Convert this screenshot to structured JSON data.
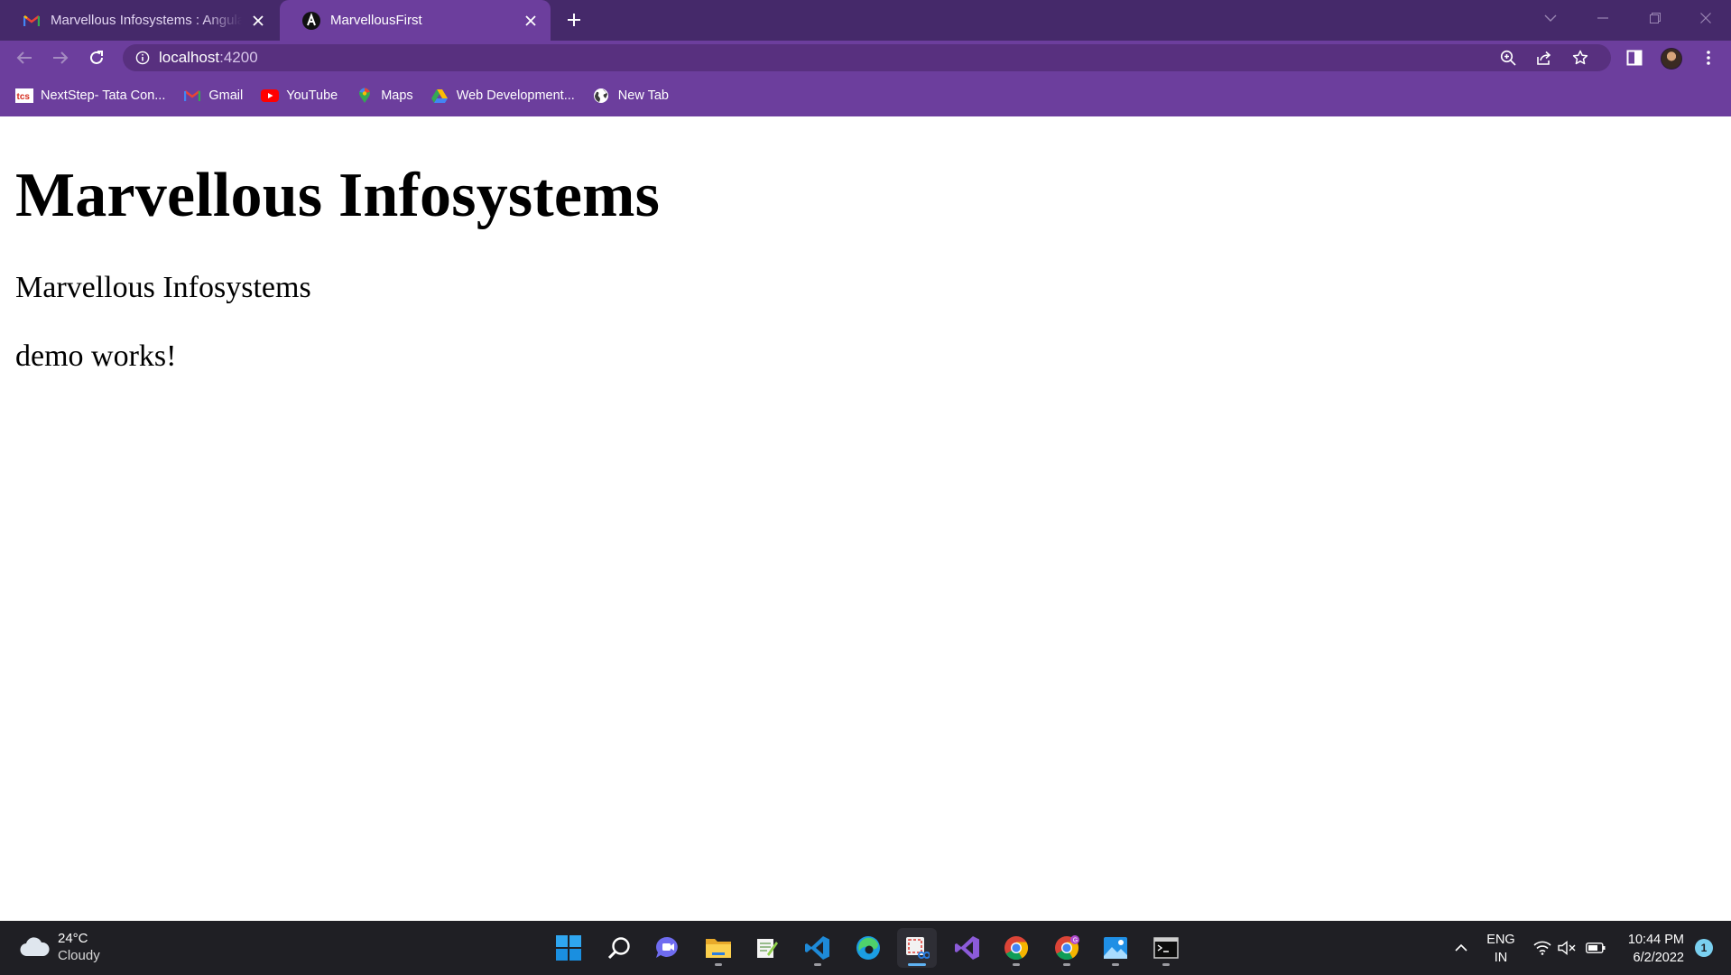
{
  "browser": {
    "tabs": [
      {
        "title": "Marvellous Infosystems : Angular",
        "favicon": "gmail-icon",
        "active": false
      },
      {
        "title": "MarvellousFirst",
        "favicon": "angular-icon",
        "active": true
      }
    ],
    "address_bar": {
      "host": "localhost",
      "port": ":4200"
    },
    "bookmarks": [
      {
        "label": "NextStep- Tata Con...",
        "icon": "tcs-icon"
      },
      {
        "label": "Gmail",
        "icon": "gmail-icon"
      },
      {
        "label": "YouTube",
        "icon": "youtube-icon"
      },
      {
        "label": "Maps",
        "icon": "maps-icon"
      },
      {
        "label": "Web Development...",
        "icon": "google-drive-icon"
      },
      {
        "label": "New Tab",
        "icon": "globe-icon"
      }
    ],
    "theme_colors": {
      "frame": "#45296a",
      "toolbar": "#6c3e9d",
      "omnibox": "#58307f"
    }
  },
  "page": {
    "heading": "Marvellous Infosystems",
    "paragraph1": "Marvellous Infosystems",
    "paragraph2": "demo works!"
  },
  "taskbar": {
    "weather": {
      "temp": "24°C",
      "condition": "Cloudy"
    },
    "apps": [
      "start-icon",
      "search-icon",
      "teams-chat-icon",
      "file-explorer-icon",
      "notepad-plus-icon",
      "vscode-icon",
      "edge-icon",
      "snipping-tool-icon",
      "visual-studio-icon",
      "chrome-icon",
      "chrome-profile-icon",
      "photos-icon",
      "terminal-icon"
    ],
    "language": {
      "line1": "ENG",
      "line2": "IN"
    },
    "clock": {
      "time": "10:44 PM",
      "date": "6/2/2022"
    },
    "notification_count": "1"
  }
}
